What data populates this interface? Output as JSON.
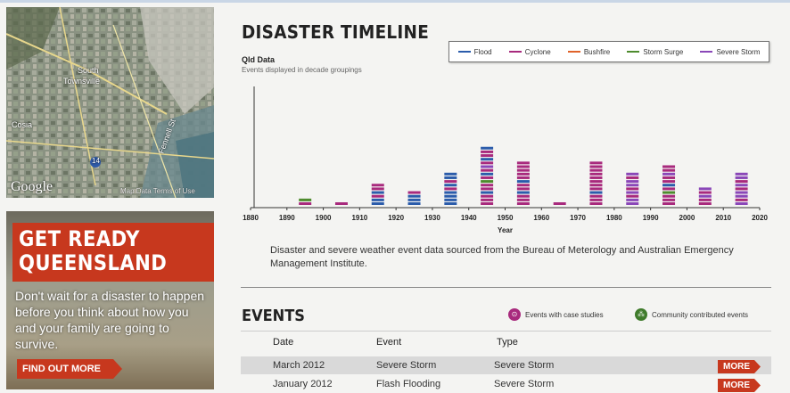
{
  "map": {
    "logo": "Google",
    "terms": "Map Data  Terms of Use",
    "labels": [
      "South",
      "Townsville",
      "Cosia",
      "Fennell St"
    ],
    "route": "14"
  },
  "promo": {
    "title": "GET READY\nQUEENSLAND",
    "text": "Don't wait for a disaster to happen before you think about how you and your family are going to survive.",
    "button": "FIND OUT MORE"
  },
  "timeline": {
    "title": "DISASTER TIMELINE",
    "dataset": "Qld Data",
    "caption": "Events displayed in decade groupings",
    "legend": [
      {
        "label": "Flood",
        "color": "#2b5cab"
      },
      {
        "label": "Cyclone",
        "color": "#a82a7d"
      },
      {
        "label": "Bushfire",
        "color": "#e0632a"
      },
      {
        "label": "Storm Surge",
        "color": "#4e8b2e"
      },
      {
        "label": "Severe Storm",
        "color": "#8a47b8"
      }
    ],
    "description": "Disaster and severe weather event data sourced from the Bureau of Meterology and Australian Emergency Management Institute."
  },
  "chart_data": {
    "type": "bar",
    "xlabel": "Year",
    "xlim": [
      1880,
      2020
    ],
    "ticks": [
      1880,
      1890,
      1900,
      1910,
      1920,
      1930,
      1940,
      1950,
      1960,
      1970,
      1980,
      1990,
      2000,
      2010,
      2020
    ],
    "series_order": [
      "Flood",
      "Cyclone",
      "Bushfire",
      "Storm Surge",
      "Severe Storm"
    ],
    "stacks": [
      {
        "decade": 1890,
        "events": [
          "Cyclone",
          "Storm Surge"
        ]
      },
      {
        "decade": 1900,
        "events": [
          "Cyclone"
        ]
      },
      {
        "decade": 1910,
        "events": [
          "Flood",
          "Flood",
          "Cyclone",
          "Flood",
          "Cyclone",
          "Cyclone"
        ]
      },
      {
        "decade": 1920,
        "events": [
          "Flood",
          "Flood",
          "Flood",
          "Cyclone"
        ]
      },
      {
        "decade": 1930,
        "events": [
          "Flood",
          "Flood",
          "Flood",
          "Flood",
          "Cyclone",
          "Flood",
          "Cyclone",
          "Flood",
          "Flood"
        ]
      },
      {
        "decade": 1940,
        "events": [
          "Cyclone",
          "Cyclone",
          "Cyclone",
          "Flood",
          "Cyclone",
          "Cyclone",
          "Storm Surge",
          "Cyclone",
          "Flood",
          "Cyclone",
          "Severe Storm",
          "Cyclone",
          "Flood",
          "Cyclone",
          "Cyclone",
          "Flood"
        ]
      },
      {
        "decade": 1950,
        "events": [
          "Cyclone",
          "Cyclone",
          "Cyclone",
          "Flood",
          "Cyclone",
          "Cyclone",
          "Flood",
          "Cyclone",
          "Cyclone",
          "Cyclone",
          "Cyclone",
          "Cyclone"
        ]
      },
      {
        "decade": 1960,
        "events": [
          "Cyclone"
        ]
      },
      {
        "decade": 1970,
        "events": [
          "Cyclone",
          "Cyclone",
          "Cyclone",
          "Flood",
          "Cyclone",
          "Cyclone",
          "Cyclone",
          "Cyclone",
          "Cyclone",
          "Cyclone",
          "Cyclone",
          "Cyclone"
        ]
      },
      {
        "decade": 1980,
        "events": [
          "Severe Storm",
          "Severe Storm",
          "Cyclone",
          "Severe Storm",
          "Cyclone",
          "Severe Storm",
          "Severe Storm",
          "Cyclone",
          "Severe Storm"
        ]
      },
      {
        "decade": 1990,
        "events": [
          "Cyclone",
          "Cyclone",
          "Cyclone",
          "Storm Surge",
          "Cyclone",
          "Flood",
          "Cyclone",
          "Cyclone",
          "Severe Storm",
          "Cyclone",
          "Cyclone"
        ]
      },
      {
        "decade": 2000,
        "events": [
          "Cyclone",
          "Cyclone",
          "Severe Storm",
          "Cyclone",
          "Severe Storm"
        ]
      },
      {
        "decade": 2010,
        "events": [
          "Severe Storm",
          "Cyclone",
          "Severe Storm",
          "Severe Storm",
          "Cyclone",
          "Severe Storm",
          "Cyclone",
          "Severe Storm",
          "Severe Storm"
        ]
      }
    ]
  },
  "events": {
    "title": "EVENTS",
    "key_case_studies": "Events with case studies",
    "key_community": "Community contributed events",
    "columns": [
      "Date",
      "Event",
      "Type"
    ],
    "rows": [
      {
        "date": "March 2012",
        "event": "Severe Storm",
        "type": "Severe Storm",
        "more": "MORE"
      },
      {
        "date": "January 2012",
        "event": "Flash Flooding",
        "type": "Severe Storm",
        "more": "MORE"
      }
    ]
  }
}
